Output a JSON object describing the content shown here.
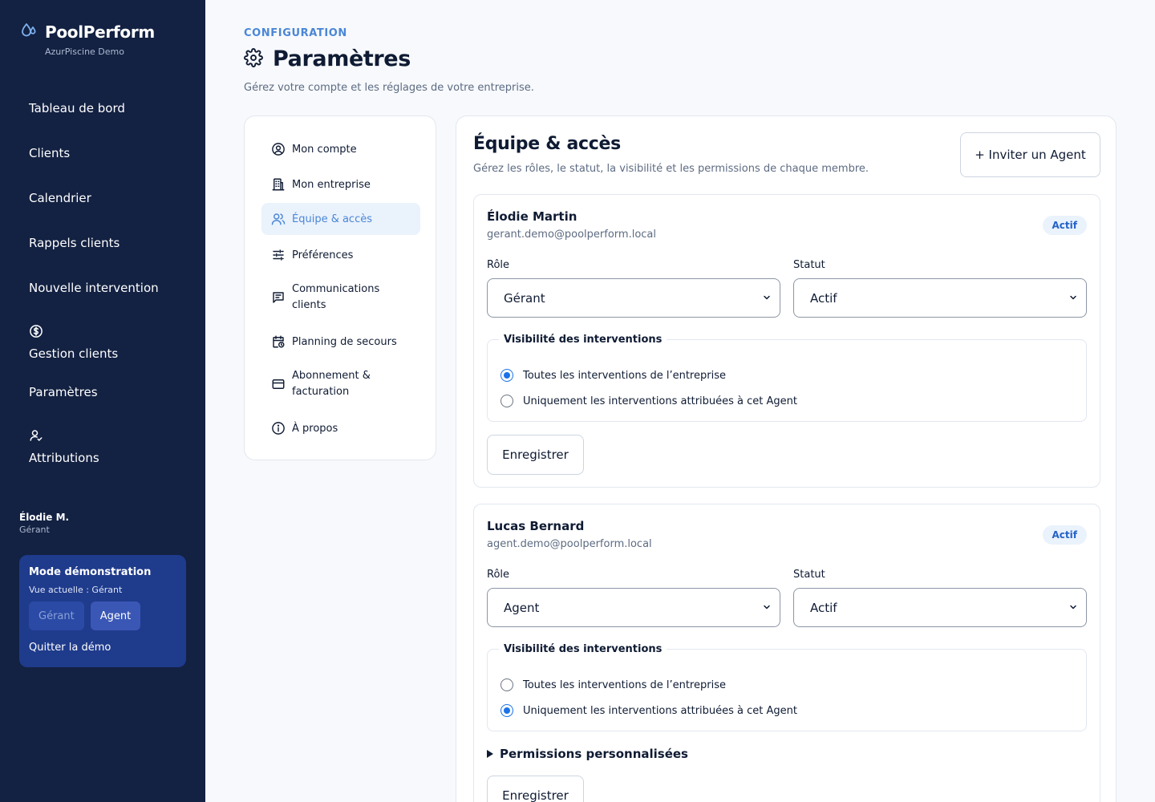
{
  "brand": {
    "name": "PoolPerform",
    "subtitle": "AzurPiscine Demo"
  },
  "sidebar": {
    "items": [
      {
        "label": "Tableau de bord"
      },
      {
        "label": "Clients"
      },
      {
        "label": "Calendrier"
      },
      {
        "label": "Rappels clients"
      },
      {
        "label": "Nouvelle intervention"
      },
      {
        "label": "Gestion clients",
        "icon": "dollar-circle-icon"
      },
      {
        "label": "Paramètres"
      },
      {
        "label": "Attributions",
        "icon": "user-check-icon"
      }
    ],
    "user": {
      "name": "Élodie M.",
      "role": "Gérant"
    },
    "demo": {
      "title": "Mode démonstration",
      "current_view": "Vue actuelle : Gérant",
      "manager_button": "Gérant",
      "agent_button": "Agent",
      "quit_label": "Quitter la démo"
    }
  },
  "header": {
    "eyebrow": "CONFIGURATION",
    "title": "Paramètres",
    "subtitle": "Gérez votre compte et les réglages de votre entreprise."
  },
  "settings_menu": {
    "items": [
      {
        "label": "Mon compte",
        "icon": "user-circle-icon"
      },
      {
        "label": "Mon entreprise",
        "icon": "building-icon"
      },
      {
        "label": "Équipe & accès",
        "icon": "users-icon",
        "active": true
      },
      {
        "label": "Préférences",
        "icon": "sliders-icon"
      },
      {
        "label": "Communications clients",
        "icon": "message-icon"
      },
      {
        "label": "Planning de secours",
        "icon": "calendar-clock-icon"
      },
      {
        "label": "Abonnement & facturation",
        "icon": "credit-card-icon"
      },
      {
        "label": "À propos",
        "icon": "info-icon"
      }
    ]
  },
  "team": {
    "title": "Équipe & accès",
    "subtitle": "Gérez les rôles, le statut, la visibilité et les permissions de chaque membre.",
    "invite_button": "+ Inviter un Agent",
    "role_label": "Rôle",
    "status_label": "Statut",
    "visibility_legend": "Visibilité des interventions",
    "visibility_options": [
      "Toutes les interventions de l’entreprise",
      "Uniquement les interventions attribuées à cet Agent"
    ],
    "save_button": "Enregistrer",
    "custom_permissions": "Permissions personnalisées",
    "members": [
      {
        "name": "Élodie Martin",
        "email": "gerant.demo@poolperform.local",
        "badge": "Actif",
        "role": "Gérant",
        "status": "Actif",
        "visibility_selected": 0
      },
      {
        "name": "Lucas Bernard",
        "email": "agent.demo@poolperform.local",
        "badge": "Actif",
        "role": "Agent",
        "status": "Actif",
        "visibility_selected": 1
      }
    ]
  }
}
